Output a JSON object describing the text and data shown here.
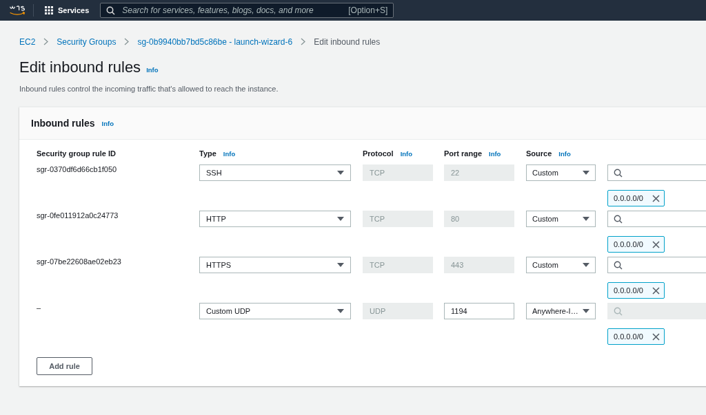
{
  "top_nav": {
    "services_label": "Services",
    "search": {
      "placeholder": "Search for services, features, blogs, docs, and more",
      "shortcut": "[Option+S]"
    }
  },
  "breadcrumbs": [
    {
      "label": "EC2",
      "link": true
    },
    {
      "label": "Security Groups",
      "link": true
    },
    {
      "label": "sg-0b9940bb7bd5c86be - launch-wizard-6",
      "link": true
    },
    {
      "label": "Edit inbound rules",
      "link": false
    }
  ],
  "page": {
    "title": "Edit inbound rules",
    "info": "Info",
    "description": "Inbound rules control the incoming traffic that's allowed to reach the instance."
  },
  "panel": {
    "title": "Inbound rules",
    "info": "Info",
    "columns": [
      {
        "label": "Security group rule ID"
      },
      {
        "label": "Type",
        "info": "Info"
      },
      {
        "label": "Protocol",
        "info": "Info"
      },
      {
        "label": "Port range",
        "info": "Info"
      },
      {
        "label": "Source",
        "info": "Info"
      }
    ],
    "rows": [
      {
        "rule_id": "sgr-0370df6d66cb1f050",
        "type": "SSH",
        "protocol": "TCP",
        "port": "22",
        "port_disabled": true,
        "source": "Custom",
        "source_search_disabled": false,
        "cidr": "0.0.0.0/0"
      },
      {
        "rule_id": "sgr-0fe011912a0c24773",
        "type": "HTTP",
        "protocol": "TCP",
        "port": "80",
        "port_disabled": true,
        "source": "Custom",
        "source_search_disabled": false,
        "cidr": "0.0.0.0/0"
      },
      {
        "rule_id": "sgr-07be22608ae02eb23",
        "type": "HTTPS",
        "protocol": "TCP",
        "port": "443",
        "port_disabled": true,
        "source": "Custom",
        "source_search_disabled": false,
        "cidr": "0.0.0.0/0"
      },
      {
        "rule_id": "–",
        "type": "Custom UDP",
        "protocol": "UDP",
        "port": "1194",
        "port_disabled": false,
        "source": "Anywhere-I…",
        "source_search_disabled": true,
        "cidr": "0.0.0.0/0"
      }
    ],
    "add_button": "Add rule"
  }
}
